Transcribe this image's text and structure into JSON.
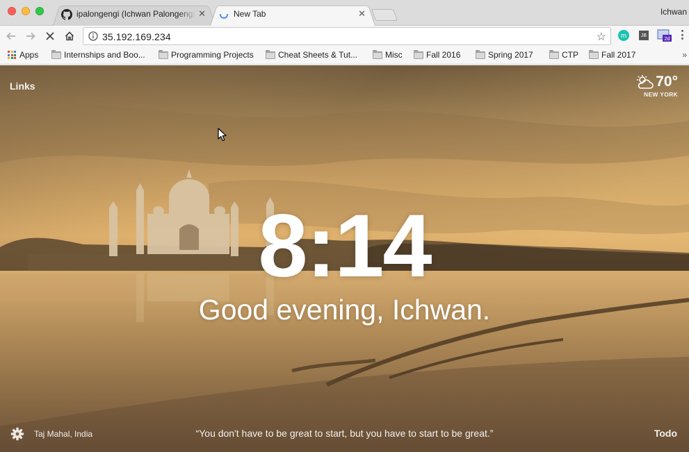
{
  "window": {
    "profile_name": "Ichwan"
  },
  "tabs": [
    {
      "title": "ipalongengi (Ichwan Palongengi)",
      "favicon": "github-icon",
      "active": false
    },
    {
      "title": "New Tab",
      "favicon": "loading-spinner-icon",
      "active": true
    }
  ],
  "toolbar": {
    "url": "35.192.169.234"
  },
  "bookmarks": {
    "apps_label": "Apps",
    "items": [
      "Internships and Boo...",
      "Programming Projects",
      "Cheat Sheets & Tut...",
      "Misc",
      "Fall 2016",
      "Spring 2017",
      "CTP",
      "Fall 2017"
    ],
    "overflow": "»"
  },
  "momentum": {
    "links_label": "Links",
    "weather": {
      "temperature": "70°",
      "location": "NEW YORK",
      "icon": "partly-cloudy-icon"
    },
    "time": "8:14",
    "greeting": "Good evening, Ichwan.",
    "photo_location": "Taj Mahal, India",
    "quote": "“You don't have to be great to start, but you have to start to be great.”",
    "todo_label": "Todo"
  },
  "colors": {
    "traffic_red": "#fc605c",
    "traffic_yellow": "#fdbc40",
    "traffic_green": "#34c84a",
    "spinner_blue": "#4a8ef0"
  }
}
